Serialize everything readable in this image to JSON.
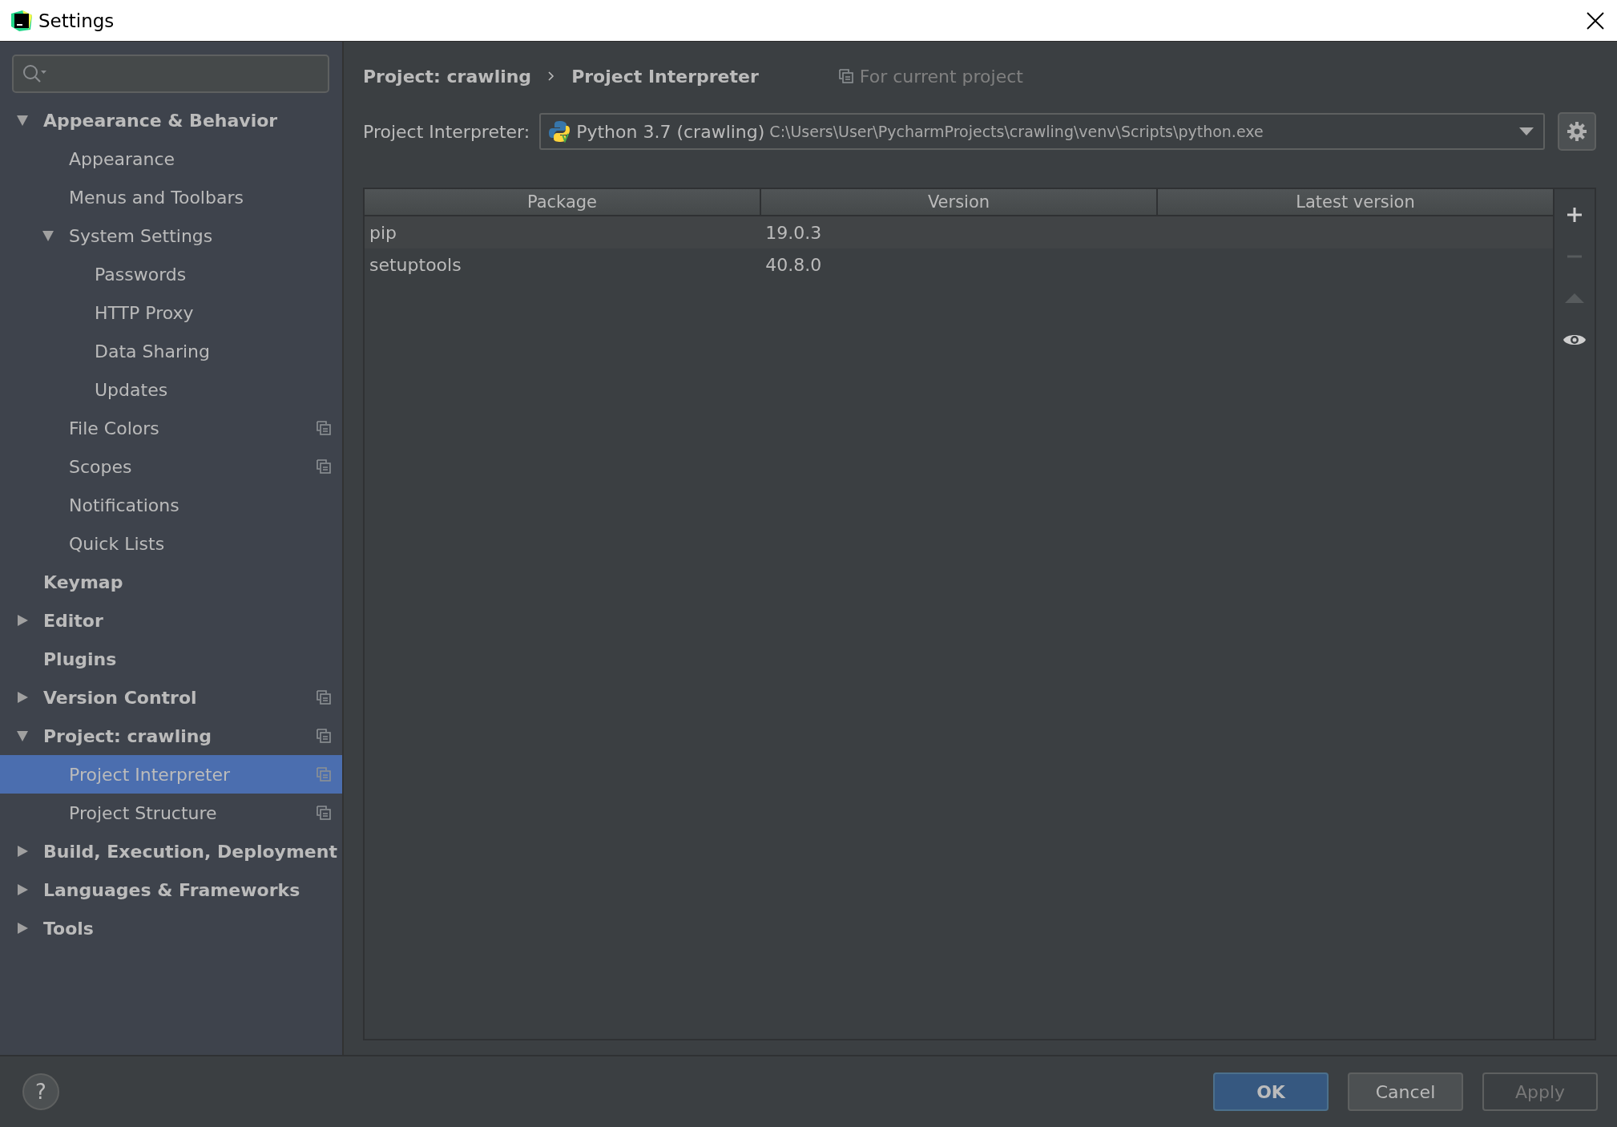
{
  "window": {
    "title": "Settings"
  },
  "help_button": "?",
  "tree": [
    {
      "label": "Appearance & Behavior",
      "expanded": true,
      "selected": false,
      "project_level": false,
      "children": [
        {
          "label": "Appearance",
          "selected": false,
          "project_level": false
        },
        {
          "label": "Menus and Toolbars",
          "selected": false,
          "project_level": false
        },
        {
          "label": "System Settings",
          "expanded": true,
          "selected": false,
          "project_level": false,
          "children": [
            {
              "label": "Passwords",
              "selected": false,
              "project_level": false
            },
            {
              "label": "HTTP Proxy",
              "selected": false,
              "project_level": false
            },
            {
              "label": "Data Sharing",
              "selected": false,
              "project_level": false
            },
            {
              "label": "Updates",
              "selected": false,
              "project_level": false
            }
          ]
        },
        {
          "label": "File Colors",
          "selected": false,
          "project_level": true
        },
        {
          "label": "Scopes",
          "selected": false,
          "project_level": true
        },
        {
          "label": "Notifications",
          "selected": false,
          "project_level": false
        },
        {
          "label": "Quick Lists",
          "selected": false,
          "project_level": false
        }
      ]
    },
    {
      "label": "Keymap",
      "selected": false,
      "project_level": false
    },
    {
      "label": "Editor",
      "expanded": false,
      "selected": false,
      "project_level": false
    },
    {
      "label": "Plugins",
      "selected": false,
      "project_level": false
    },
    {
      "label": "Version Control",
      "expanded": false,
      "selected": false,
      "project_level": true
    },
    {
      "label": "Project: crawling",
      "expanded": true,
      "selected": false,
      "project_level": true,
      "children": [
        {
          "label": "Project Interpreter",
          "selected": true,
          "project_level": true
        },
        {
          "label": "Project Structure",
          "selected": false,
          "project_level": true
        }
      ]
    },
    {
      "label": "Build, Execution, Deployment",
      "expanded": false,
      "selected": false,
      "project_level": false
    },
    {
      "label": "Languages & Frameworks",
      "expanded": false,
      "selected": false,
      "project_level": false
    },
    {
      "label": "Tools",
      "expanded": false,
      "selected": false,
      "project_level": false
    }
  ],
  "breadcrumb": [
    "Project: crawling",
    "Project Interpreter"
  ],
  "scope_note": "For current project",
  "interpreter": {
    "label": "Project Interpreter:",
    "name": "Python 3.7 (crawling)",
    "path": "C:\\Users\\User\\PycharmProjects\\crawling\\venv\\Scripts\\python.exe"
  },
  "table": {
    "columns": [
      "Package",
      "Version",
      "Latest version"
    ],
    "rows": [
      [
        "pip",
        "19.0.3"
      ],
      [
        "setuptools",
        "40.8.0"
      ]
    ]
  },
  "toolbar": [
    {
      "kind": "add",
      "disabled": false
    },
    {
      "kind": "remove",
      "disabled": true
    },
    {
      "kind": "upgrade",
      "disabled": true
    },
    {
      "kind": "show",
      "disabled": false
    }
  ],
  "buttons": [
    {
      "label": "OK",
      "kind": "default",
      "disabled": false
    },
    {
      "label": "Cancel",
      "kind": "normal",
      "disabled": false
    },
    {
      "label": "Apply",
      "kind": "normal",
      "disabled": true
    }
  ]
}
